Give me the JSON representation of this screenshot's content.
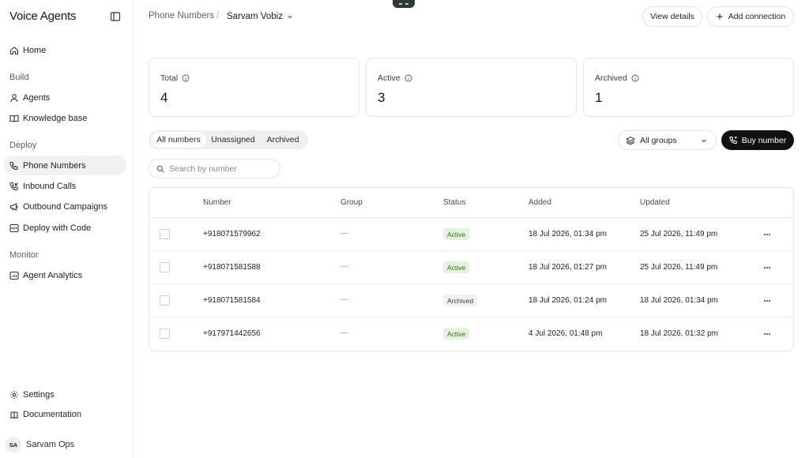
{
  "app": {
    "title": "Voice Agents"
  },
  "sidebar": {
    "home": "Home",
    "sections": {
      "build": "Build",
      "deploy": "Deploy",
      "monitor": "Monitor"
    },
    "build_items": [
      {
        "label": "Agents",
        "icon": "agent-icon"
      },
      {
        "label": "Knowledge base",
        "icon": "book-icon"
      }
    ],
    "deploy_items": [
      {
        "label": "Phone Numbers",
        "icon": "phone-icon",
        "active": true
      },
      {
        "label": "Inbound Calls",
        "icon": "phone-incoming-icon"
      },
      {
        "label": "Outbound Campaigns",
        "icon": "megaphone-icon"
      },
      {
        "label": "Deploy with Code",
        "icon": "code-icon"
      }
    ],
    "monitor_items": [
      {
        "label": "Agent Analytics",
        "icon": "chart-icon"
      }
    ],
    "footer_items": [
      {
        "label": "Settings",
        "icon": "gear-icon"
      },
      {
        "label": "Documentation",
        "icon": "docs-icon"
      }
    ],
    "user": {
      "initials": "SA",
      "name": "Sarvam Ops"
    }
  },
  "header": {
    "breadcrumb_root": "Phone Numbers",
    "breadcrumb_separator": "/",
    "breadcrumb_current": "Sarvam Vobiz",
    "view_details": "View details",
    "add_connection": "Add connection"
  },
  "stats": [
    {
      "label": "Total",
      "value": "4"
    },
    {
      "label": "Active",
      "value": "3"
    },
    {
      "label": "Archived",
      "value": "1"
    }
  ],
  "filters": {
    "tabs": [
      "All numbers",
      "Unassigned",
      "Archived"
    ],
    "selected_tab": "All numbers",
    "group_select": "All groups",
    "buy_button": "Buy number",
    "search_placeholder": "Search by number"
  },
  "table": {
    "columns": [
      "Number",
      "Group",
      "Status",
      "Added",
      "Updated"
    ],
    "rows": [
      {
        "number": "+918071579962",
        "group": "—",
        "status": "Active",
        "added": "18 Jul 2026, 01:34 pm",
        "updated": "25 Jul 2026, 11:49 pm"
      },
      {
        "number": "+918071581588",
        "group": "—",
        "status": "Active",
        "added": "18 Jul 2026, 01:27 pm",
        "updated": "25 Jul 2026, 11:49 pm"
      },
      {
        "number": "+918071581584",
        "group": "—",
        "status": "Archived",
        "added": "18 Jul 2026, 01:24 pm",
        "updated": "18 Jul 2026, 01:34 pm"
      },
      {
        "number": "+917971442656",
        "group": "—",
        "status": "Active",
        "added": "4 Jul 2026, 01:48 pm",
        "updated": "18 Jul 2026, 01:32 pm"
      }
    ]
  },
  "colors": {
    "active_badge_bg": "#e4f3dc",
    "active_badge_text": "#2f6b25",
    "archived_badge_bg": "#f0f0f0",
    "primary_button": "#111111"
  }
}
